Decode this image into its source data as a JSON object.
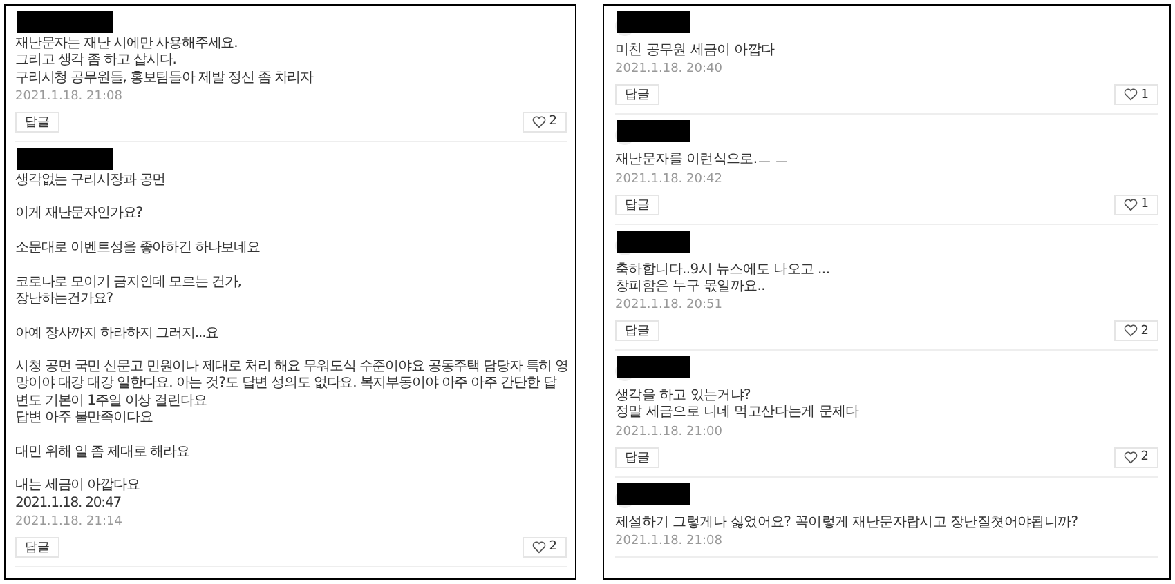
{
  "panels": [
    {
      "comments": [
        {
          "text": "재난문자는 재난 시에만 사용해주세요.\n그리고 생각 좀 하고 삽시다.\n구리시청 공무원들, 홍보팀들아 제발 정신 좀 차리자",
          "date": "2021.1.18. 21:08",
          "reply": "답글",
          "likes": "2"
        },
        {
          "text": "생각없는 구리시장과 공먼\n\n이게 재난문자인가요?\n\n소문대로 이벤트성을 좋아하긴 하나보네요\n\n코로나로 모이기 금지인데 모르는 건가,\n장난하는건가요?\n\n아예 장사까지 하라하지 그러지...요\n\n시청 공먼 국민 신문고 민원이나 제대로 처리 해요 무워도식 수준이야요 공동주택 담당자 특히 영\n망이야 대강 대강 일한다요. 아는 것?도 답변 성의도 없다요. 복지부동이야 아주 아주 간단한 답\n변도 기본이 1주일 이상 걸린다요\n답변 아주 불만족이다요\n\n대민 위해 일 좀 제대로 해라요\n\n내는 세금이 아깝다요\n2021.1.18. 20:47",
          "date": "2021.1.18. 21:14",
          "reply": "답글",
          "likes": "2"
        }
      ]
    },
    {
      "comments": [
        {
          "text": "미친 공무원 세금이 아깝다",
          "date": "2021.1.18. 20:40",
          "reply": "답글",
          "likes": "1"
        },
        {
          "text": "재난문자를 이런식으로.ㅡ ㅡ",
          "date": "2021.1.18. 20:42",
          "reply": "답글",
          "likes": "1"
        },
        {
          "text": "축하합니다..9시 뉴스에도 나오고 ...\n창피함은 누구 몫일까요..",
          "date": "2021.1.18. 20:51",
          "reply": "답글",
          "likes": "2"
        },
        {
          "text": "생각을 하고 있는거냐?\n정말 세금으로 니네 먹고산다는게 문제다",
          "date": "2021.1.18. 21:00",
          "reply": "답글",
          "likes": "2"
        },
        {
          "text": "제설하기 그렇게나 싫었어요? 꼭이렇게 재난문자랍시고 장난질쳣어야됩니까?",
          "date": "2021.1.18. 21:08"
        }
      ]
    }
  ]
}
